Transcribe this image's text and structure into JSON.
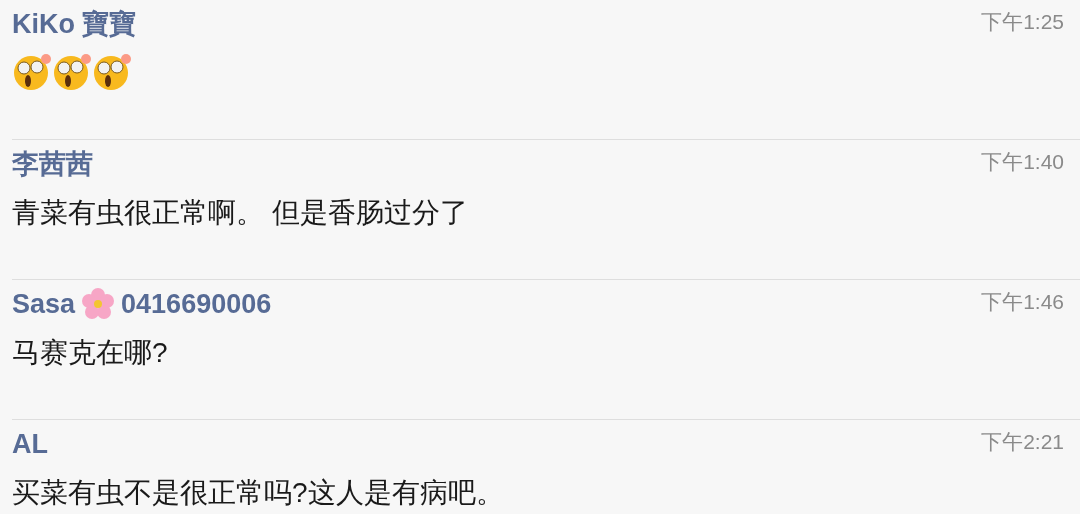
{
  "comments": [
    {
      "name_parts": [
        {
          "kind": "text",
          "text": "KiKo 寶寶"
        }
      ],
      "time": "下午1:25",
      "body": [
        {
          "kind": "emoji"
        },
        {
          "kind": "emoji"
        },
        {
          "kind": "emoji"
        }
      ]
    },
    {
      "name_parts": [
        {
          "kind": "text",
          "text": "李茜茜"
        }
      ],
      "time": "下午1:40",
      "body": [
        {
          "kind": "text",
          "text": "青菜有虫很正常啊。 但是香肠过分了"
        }
      ]
    },
    {
      "name_parts": [
        {
          "kind": "text",
          "text": "Sasa"
        },
        {
          "kind": "flower"
        },
        {
          "kind": "text",
          "text": "0416690006"
        }
      ],
      "time": "下午1:46",
      "body": [
        {
          "kind": "text",
          "text": "马赛克在哪?"
        }
      ]
    },
    {
      "name_parts": [
        {
          "kind": "text",
          "text": "AL"
        }
      ],
      "time": "下午2:21",
      "body": [
        {
          "kind": "text",
          "text": "买菜有虫不是很正常吗?这人是有病吧。"
        }
      ]
    }
  ]
}
